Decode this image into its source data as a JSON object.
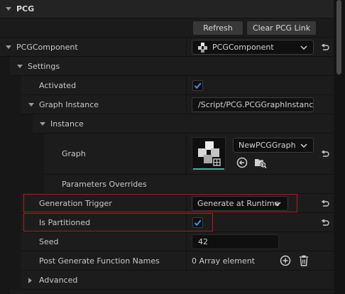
{
  "title": "PCG",
  "buttons": {
    "refresh": "Refresh",
    "clear_link": "Clear PCG Link"
  },
  "pcg_component": {
    "label": "PCGComponent",
    "value": "PCGComponent"
  },
  "settings": {
    "label": "Settings",
    "activated": {
      "label": "Activated",
      "checked": true
    },
    "graph_instance": {
      "label": "Graph Instance",
      "path": "/Script/PCG.PCGGraphInstanc"
    },
    "instance": {
      "label": "Instance",
      "graph": {
        "label": "Graph",
        "value": "NewPCGGraph"
      },
      "parameters_overrides": {
        "label": "Parameters Overrides"
      }
    },
    "generation_trigger": {
      "label": "Generation Trigger",
      "value": "Generate at Runtime"
    },
    "is_partitioned": {
      "label": "Is Partitioned",
      "checked": true
    },
    "seed": {
      "label": "Seed",
      "value": "42"
    },
    "post_generate": {
      "label": "Post Generate Function Names",
      "value": "0 Array element"
    }
  },
  "advanced": {
    "label": "Advanced"
  },
  "colors": {
    "accent": "#1f6fd1",
    "highlight": "#b01e1e",
    "check": "#3d8ef0"
  },
  "icons": [
    "collapse-arrow-icon",
    "reset-to-default-icon",
    "pcg-component-icon",
    "chevron-down-icon",
    "use-selected-icon",
    "browse-icon",
    "add-element-icon",
    "delete-element-icon",
    "expand-arrow-icon"
  ]
}
